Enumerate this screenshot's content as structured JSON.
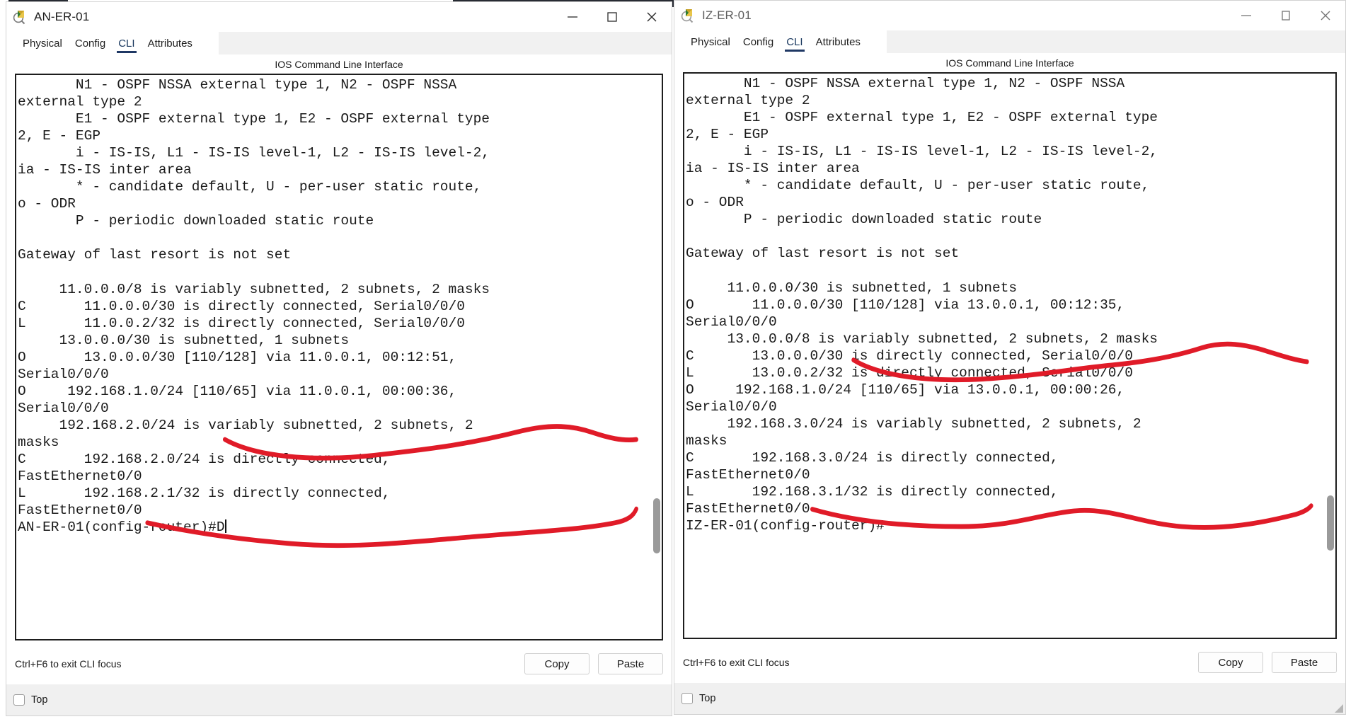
{
  "app": {
    "cli_heading": "IOS Command Line Interface",
    "tabs": [
      "Physical",
      "Config",
      "CLI",
      "Attributes"
    ],
    "active_tab": "CLI",
    "hint": "Ctrl+F6 to exit CLI focus",
    "copy_label": "Copy",
    "paste_label": "Paste",
    "top_label": "Top",
    "annotation_color": "#e01b28"
  },
  "left_window": {
    "title": "AN-ER-01",
    "active": true,
    "minimize": "–",
    "maximize": "□",
    "close": "✕",
    "terminal_text": "       N1 - OSPF NSSA external type 1, N2 - OSPF NSSA\nexternal type 2\n       E1 - OSPF external type 1, E2 - OSPF external type\n2, E - EGP\n       i - IS-IS, L1 - IS-IS level-1, L2 - IS-IS level-2,\nia - IS-IS inter area\n       * - candidate default, U - per-user static route,\no - ODR\n       P - periodic downloaded static route\n\nGateway of last resort is not set\n\n     11.0.0.0/8 is variably subnetted, 2 subnets, 2 masks\nC       11.0.0.0/30 is directly connected, Serial0/0/0\nL       11.0.0.2/32 is directly connected, Serial0/0/0\n     13.0.0.0/30 is subnetted, 1 subnets\nO       13.0.0.0/30 [110/128] via 11.0.0.1, 00:12:51,\nSerial0/0/0\nO     192.168.1.0/24 [110/65] via 11.0.0.1, 00:00:36,\nSerial0/0/0\n     192.168.2.0/24 is variably subnetted, 2 subnets, 2\nmasks\nC       192.168.2.0/24 is directly connected,\nFastEthernet0/0\nL       192.168.2.1/32 is directly connected,\nFastEthernet0/0\n",
    "prompt": "AN-ER-01(config-router)#D",
    "annotated_routes": [
      {
        "code": "O",
        "network": "13.0.0.0/30",
        "metric": "[110/128]",
        "via": "11.0.0.1",
        "uptime": "00:12:51",
        "interface": "Serial0/0/0"
      },
      {
        "code": "O",
        "network": "192.168.1.0/24",
        "metric": "[110/65]",
        "via": "11.0.0.1",
        "uptime": "00:00:36",
        "interface": "Serial0/0/0"
      }
    ]
  },
  "right_window": {
    "title": "IZ-ER-01",
    "active": false,
    "minimize": "–",
    "maximize": "□",
    "close": "✕",
    "terminal_text": "       N1 - OSPF NSSA external type 1, N2 - OSPF NSSA\nexternal type 2\n       E1 - OSPF external type 1, E2 - OSPF external type\n2, E - EGP\n       i - IS-IS, L1 - IS-IS level-1, L2 - IS-IS level-2,\nia - IS-IS inter area\n       * - candidate default, U - per-user static route,\no - ODR\n       P - periodic downloaded static route\n\nGateway of last resort is not set\n\n     11.0.0.0/30 is subnetted, 1 subnets\nO       11.0.0.0/30 [110/128] via 13.0.0.1, 00:12:35,\nSerial0/0/0\n     13.0.0.0/8 is variably subnetted, 2 subnets, 2 masks\nC       13.0.0.0/30 is directly connected, Serial0/0/0\nL       13.0.0.2/32 is directly connected, Serial0/0/0\nO     192.168.1.0/24 [110/65] via 13.0.0.1, 00:00:26,\nSerial0/0/0\n     192.168.3.0/24 is variably subnetted, 2 subnets, 2\nmasks\nC       192.168.3.0/24 is directly connected,\nFastEthernet0/0\nL       192.168.3.1/32 is directly connected,\nFastEthernet0/0\n",
    "prompt": "IZ-ER-01(config-router)#",
    "annotated_routes": [
      {
        "code": "O",
        "network": "11.0.0.0/30",
        "metric": "[110/128]",
        "via": "13.0.0.1",
        "uptime": "00:12:35",
        "interface": "Serial0/0/0"
      },
      {
        "code": "O",
        "network": "192.168.1.0/24",
        "metric": "[110/65]",
        "via": "13.0.0.1",
        "uptime": "00:00:26",
        "interface": "Serial0/0/0"
      }
    ]
  }
}
